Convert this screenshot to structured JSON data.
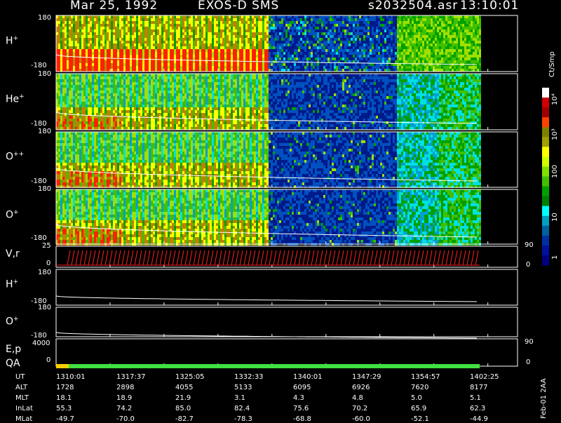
{
  "header": {
    "date": "Mar 25, 1992",
    "instrument": "EXOS-D SMS",
    "file": "s2032504.asr",
    "time": "13:10:01"
  },
  "panels": [
    {
      "key": "h_plus",
      "label": "H",
      "sup": "+",
      "top": "180",
      "bottom": "-180"
    },
    {
      "key": "he_plus",
      "label": "He",
      "sup": "+",
      "top": "180",
      "bottom": "-180"
    },
    {
      "key": "o_pp",
      "label": "O",
      "sup": "++",
      "top": "180",
      "bottom": "-180"
    },
    {
      "key": "o_plus",
      "label": "O",
      "sup": "+",
      "top": "180",
      "bottom": "-180"
    }
  ],
  "line_panels": {
    "vr": {
      "label": "V,r",
      "left_top": "25",
      "left_bottom": "0",
      "right_top": "90",
      "right_bottom": "0"
    },
    "h": {
      "label": "H",
      "sup": "+",
      "top": "180",
      "bottom": "-180"
    },
    "o": {
      "label": "O",
      "sup": "+",
      "top": "180",
      "bottom": "-180"
    },
    "ep": {
      "label": "E,p",
      "top": "4000",
      "bottom": "0",
      "right_top": "90",
      "right_bottom": "0"
    },
    "qa": {
      "label": "QA"
    }
  },
  "colorbar": {
    "unit": "Ct/Smp",
    "labels": [
      "10⁴",
      "10³",
      "100",
      "10",
      "1"
    ],
    "colors": [
      "#ffffff",
      "#d00000",
      "#a00000",
      "#ff4000",
      "#808000",
      "#a0a000",
      "#ffff00",
      "#d0ff00",
      "#80e000",
      "#40c000",
      "#00a000",
      "#008000",
      "#00ffff",
      "#00a0c0",
      "#0060a0",
      "#0030a0",
      "#0010a0",
      "#000080"
    ]
  },
  "table": {
    "rows": [
      {
        "name": "UT",
        "values": [
          "1310:01",
          "1317:37",
          "1325:05",
          "1332:33",
          "1340:01",
          "1347:29",
          "1354:57",
          "1402:25"
        ]
      },
      {
        "name": "ALT",
        "values": [
          "1728",
          "2898",
          "4055",
          "5133",
          "6095",
          "6926",
          "7620",
          "8177"
        ]
      },
      {
        "name": "MLT",
        "values": [
          "18.1",
          "18.9",
          "21.9",
          "3.1",
          "4.3",
          "4.8",
          "5.0",
          "5.1"
        ]
      },
      {
        "name": "InLat",
        "values": [
          "55.3",
          "74.2",
          "85.0",
          "82.4",
          "75.6",
          "70.2",
          "65.9",
          "62.3"
        ]
      },
      {
        "name": "MLat",
        "values": [
          "-49.7",
          "-70.0",
          "-82.7",
          "-78.3",
          "-68.8",
          "-60.0",
          "-52.1",
          "-44.9"
        ]
      }
    ]
  },
  "side_note": "Feb-01 2AA",
  "chart_data": {
    "type": "heatmap",
    "title": "Mar 25, 1992   EXOS-D SMS",
    "x_ticks": [
      "1310:01",
      "1317:37",
      "1325:05",
      "1332:33",
      "1340:01",
      "1347:29",
      "1354:57",
      "1402:25"
    ],
    "series": [
      {
        "name": "H+",
        "ylim": [
          -180,
          180
        ]
      },
      {
        "name": "He+",
        "ylim": [
          -180,
          180
        ]
      },
      {
        "name": "O++",
        "ylim": [
          -180,
          180
        ]
      },
      {
        "name": "O+",
        "ylim": [
          -180,
          180
        ]
      }
    ],
    "colorbar_unit": "Ct/Smp",
    "colorbar_range": [
      1,
      10000
    ],
    "colorbar_scale": "log"
  }
}
